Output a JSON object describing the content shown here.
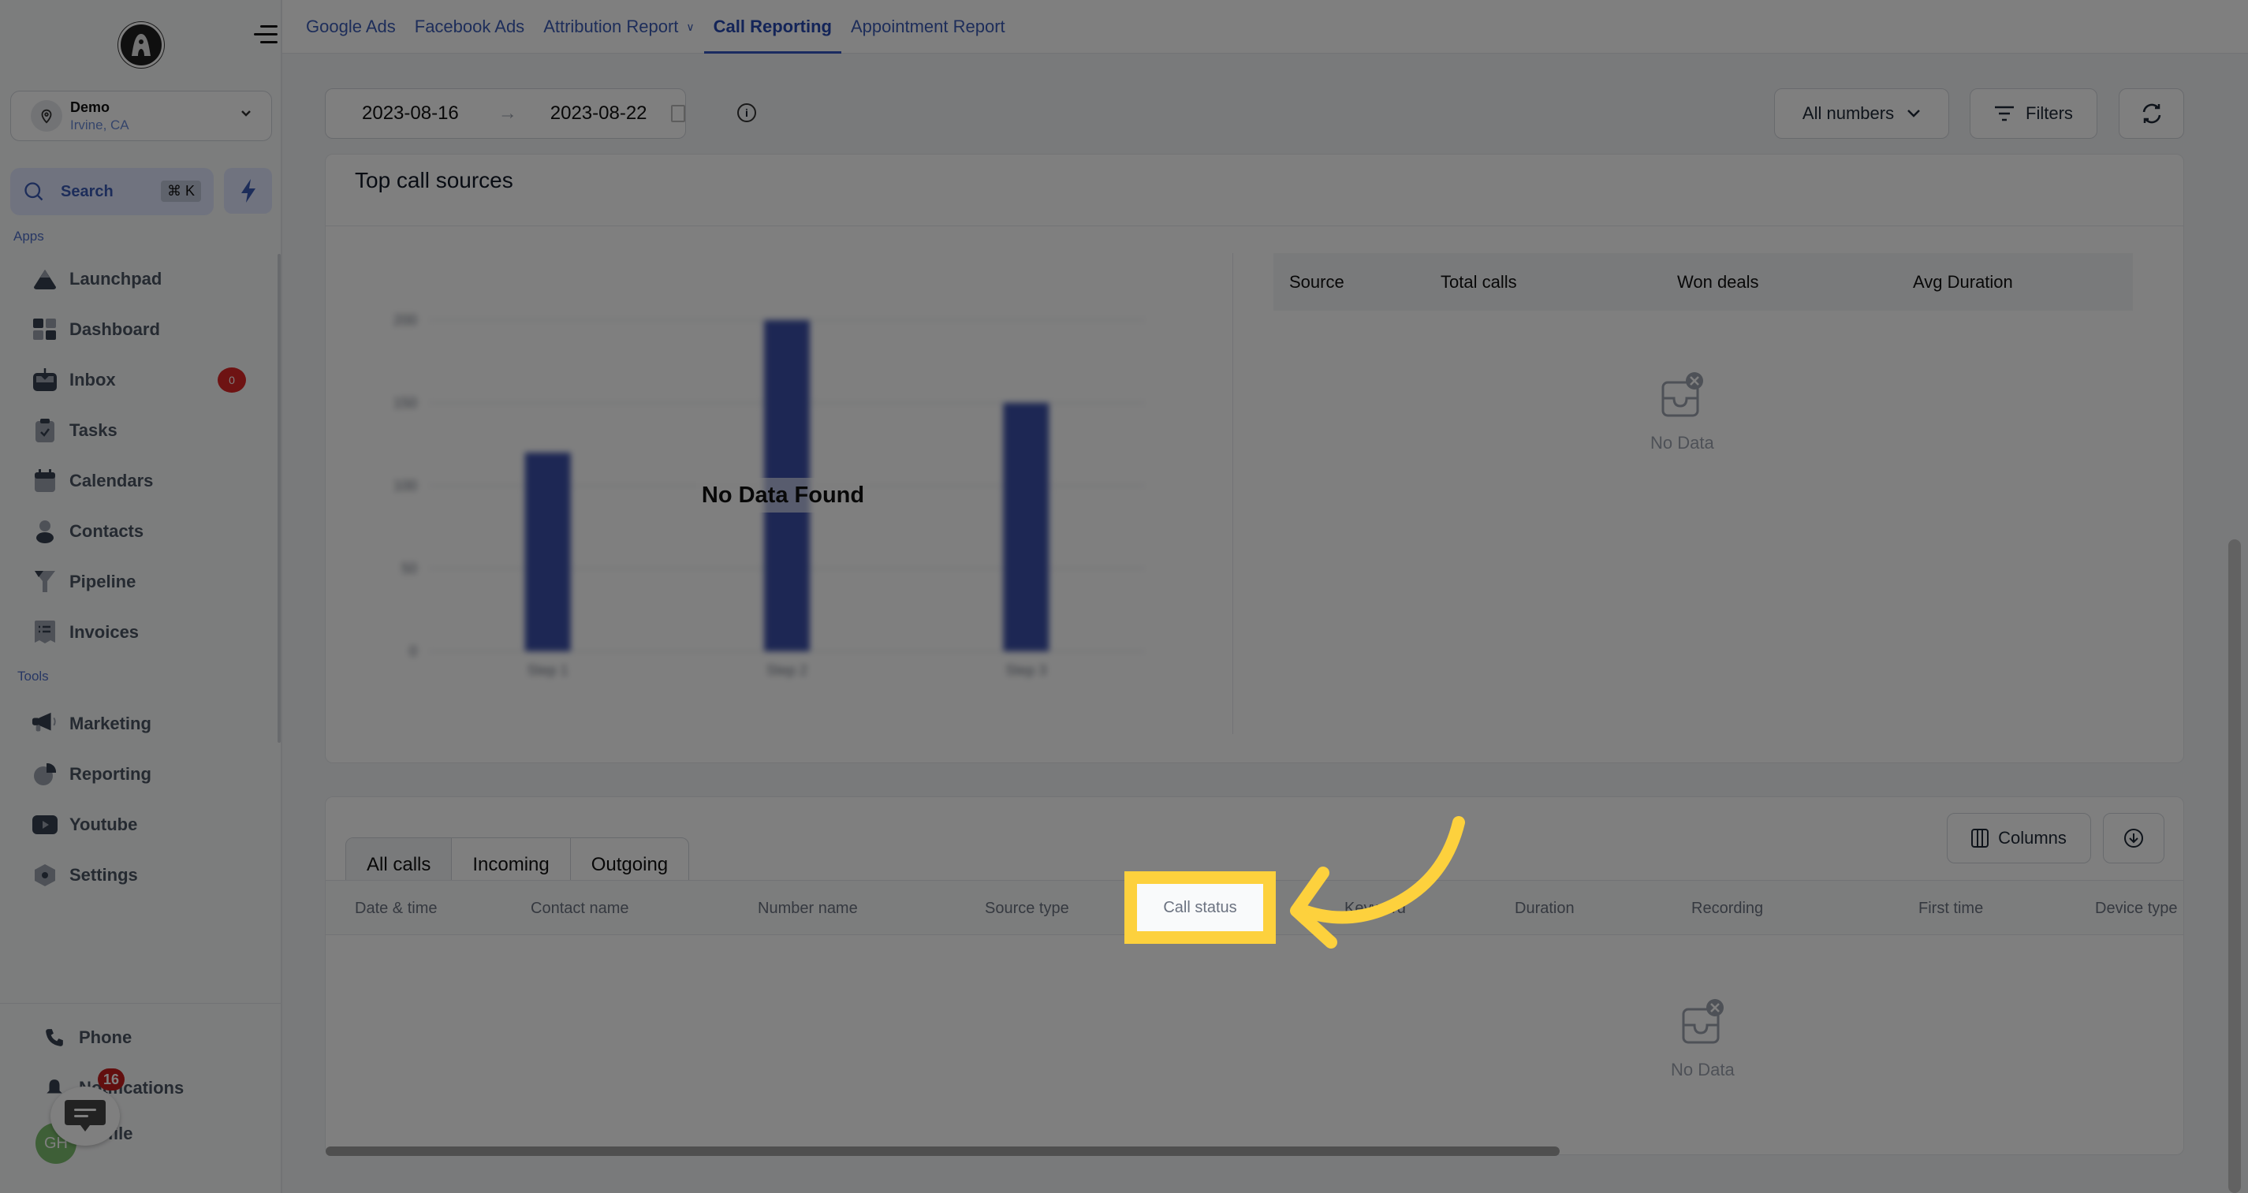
{
  "sidebar": {
    "location": {
      "name": "Demo",
      "subtitle": "Irvine, CA"
    },
    "search": {
      "label": "Search",
      "shortcut": "⌘ K"
    },
    "apps_label": "Apps",
    "tools_label": "Tools",
    "apps": [
      {
        "label": "Launchpad",
        "icon": "launchpad-icon"
      },
      {
        "label": "Dashboard",
        "icon": "dashboard-icon"
      },
      {
        "label": "Inbox",
        "icon": "inbox-icon",
        "badge": "0"
      },
      {
        "label": "Tasks",
        "icon": "tasks-icon"
      },
      {
        "label": "Calendars",
        "icon": "calendar-icon"
      },
      {
        "label": "Contacts",
        "icon": "contacts-icon"
      },
      {
        "label": "Pipeline",
        "icon": "pipeline-icon"
      },
      {
        "label": "Invoices",
        "icon": "invoices-icon"
      }
    ],
    "tools": [
      {
        "label": "Marketing",
        "icon": "megaphone-icon"
      },
      {
        "label": "Reporting",
        "icon": "pie-chart-icon"
      },
      {
        "label": "Youtube",
        "icon": "youtube-icon"
      },
      {
        "label": "Settings",
        "icon": "settings-icon"
      }
    ],
    "bottom": [
      {
        "label": "Phone",
        "icon": "phone-icon"
      },
      {
        "label": "Notifications",
        "icon": "bell-icon"
      },
      {
        "label": "Profile",
        "icon": "avatar"
      }
    ],
    "avatar_initials": "GH",
    "chat_badge": "16"
  },
  "topnav": {
    "tabs": [
      {
        "label": "Google Ads",
        "active": false
      },
      {
        "label": "Facebook Ads",
        "active": false
      },
      {
        "label": "Attribution Report",
        "active": false,
        "dropdown": true
      },
      {
        "label": "Call Reporting",
        "active": true
      },
      {
        "label": "Appointment Report",
        "active": false
      }
    ]
  },
  "toolbar": {
    "date_start": "2023-08-16",
    "date_end": "2023-08-22",
    "numbers_select": "All numbers",
    "filters_label": "Filters"
  },
  "top_call_sources": {
    "title": "Top call sources",
    "no_data_overlay": "No Data Found",
    "table_headers": [
      "Source",
      "Total calls",
      "Won deals",
      "Avg Duration"
    ],
    "empty_text": "No Data"
  },
  "chart_data": {
    "type": "bar",
    "title": "",
    "placeholder": true,
    "categories": [
      "Step 1",
      "Step 2",
      "Step 3"
    ],
    "values": [
      120,
      200,
      150
    ],
    "yticks": [
      0,
      50,
      100,
      150,
      200
    ],
    "ylim": [
      0,
      200
    ],
    "xlabel": "",
    "ylabel": "",
    "grid": true,
    "color": "#3b4fa8"
  },
  "calls": {
    "segments": [
      {
        "label": "All calls",
        "active": true
      },
      {
        "label": "Incoming",
        "active": false
      },
      {
        "label": "Outgoing",
        "active": false
      }
    ],
    "columns_label": "Columns",
    "headers": [
      "Date & time",
      "Contact name",
      "Number name",
      "Source type",
      "Call status",
      "Keyword",
      "Duration",
      "Recording",
      "First time",
      "Device type"
    ],
    "empty_text": "No Data"
  },
  "annotation": {
    "highlight_label": "Call status",
    "highlight_color": "#fdd13d"
  }
}
